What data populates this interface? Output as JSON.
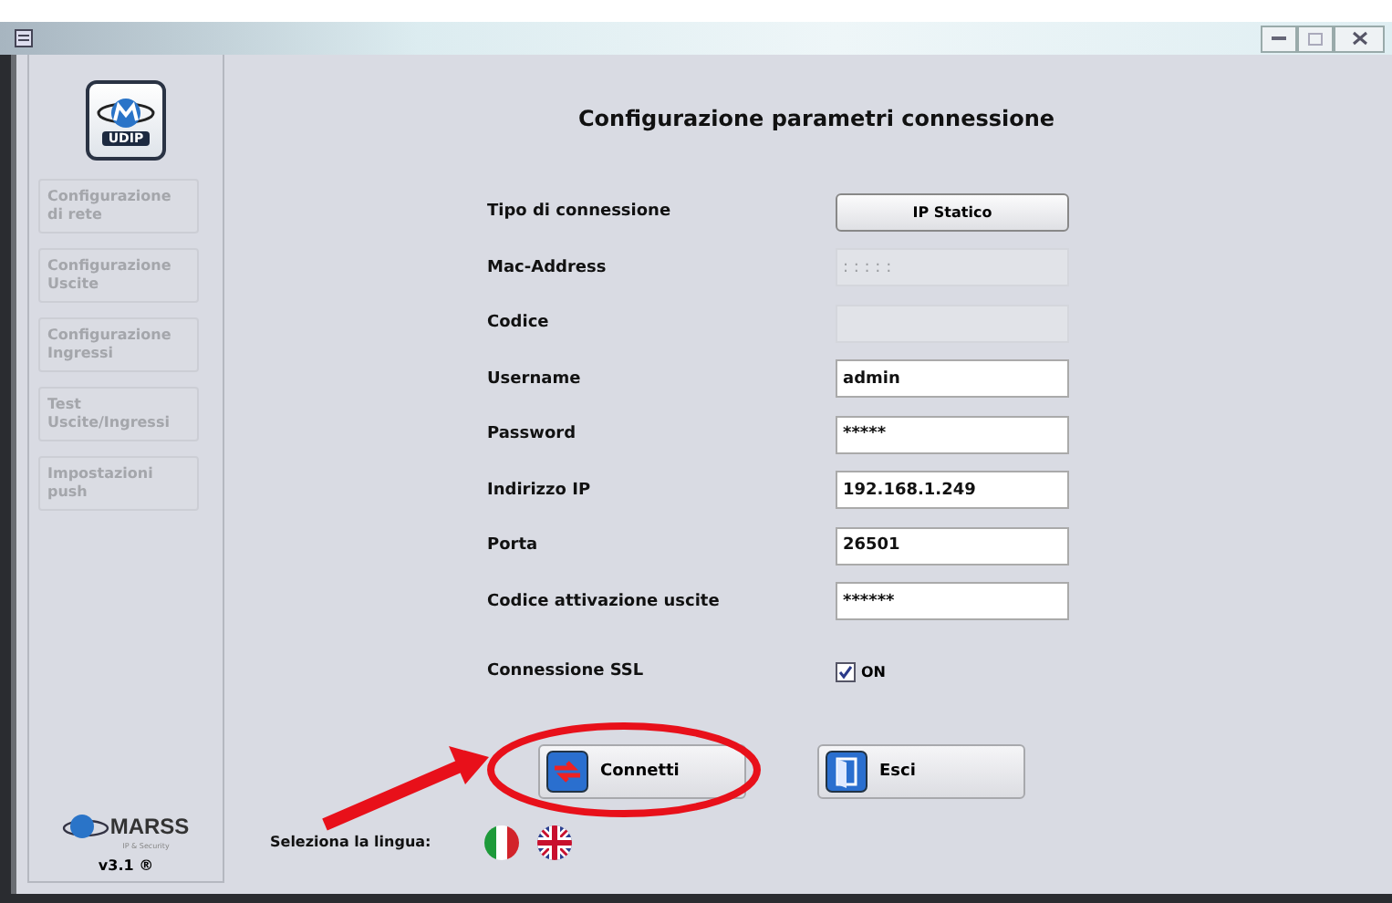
{
  "sidebar": {
    "logo": "UDIP",
    "items": [
      {
        "label": "Configurazione di rete",
        "disabled": true
      },
      {
        "label": "Configurazione Uscite",
        "disabled": true
      },
      {
        "label": "Configurazione Ingressi",
        "disabled": true
      },
      {
        "label": "Test Uscite/Ingressi",
        "disabled": true
      },
      {
        "label": "Impostazioni push",
        "disabled": true
      }
    ],
    "brand": "MARSS",
    "brand_tagline": "IP & Security",
    "version": "v3.1 ®"
  },
  "title": "Configurazione parametri connessione",
  "fields": [
    {
      "kind": "button",
      "label": "Tipo di connessione",
      "value": "IP Statico"
    },
    {
      "kind": "input",
      "label": "Mac-Address",
      "placeholder": ": : : : :",
      "disabled": true
    },
    {
      "kind": "input",
      "label": "Codice",
      "disabled": true
    },
    {
      "kind": "input",
      "label": "Username",
      "value": "admin",
      "disabled": false
    },
    {
      "kind": "input",
      "label": "Password",
      "value": "*****",
      "disabled": false
    },
    {
      "kind": "input",
      "label": "Indirizzo IP",
      "value": "192.168.1.249",
      "disabled": false
    },
    {
      "kind": "input",
      "label": "Porta",
      "value": "26501",
      "disabled": false
    },
    {
      "kind": "input",
      "label": "Codice attivazione uscite",
      "value": "******",
      "disabled": false
    },
    {
      "kind": "checkbox",
      "label": "Connessione SSL",
      "value": "ON",
      "checked": true
    }
  ],
  "buttons": [
    {
      "kind": "connect",
      "label": "Connetti"
    },
    {
      "kind": "exit",
      "label": "Esci"
    }
  ],
  "language": {
    "label": "Seleziona la lingua:",
    "flags": [
      {
        "kind": "it"
      },
      {
        "kind": "uk"
      }
    ]
  }
}
